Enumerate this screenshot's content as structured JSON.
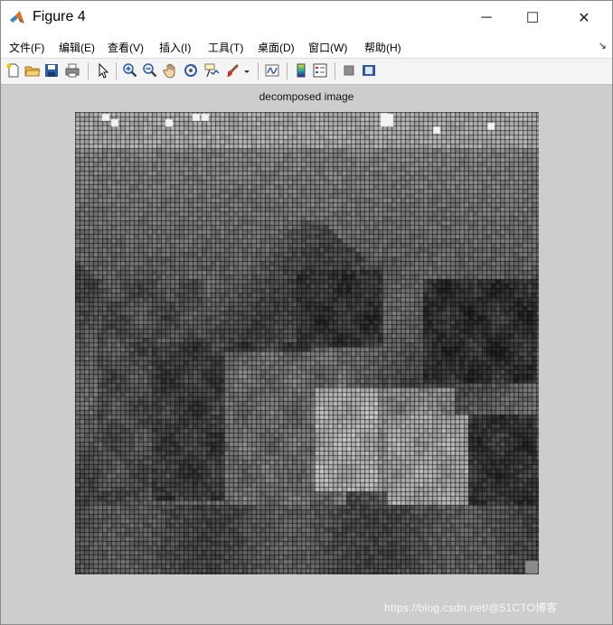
{
  "window": {
    "title": "Figure 4",
    "controls": {
      "minimize": "─",
      "maximize": "☐",
      "close": "✕"
    }
  },
  "menubar": {
    "items": [
      "文件(F)",
      "编辑(E)",
      "查看(V)",
      "插入(I)",
      "工具(T)",
      "桌面(D)",
      "窗口(W)",
      "帮助(H)"
    ],
    "dock_glyph": "↘"
  },
  "toolbar": {
    "buttons": [
      {
        "name": "new-figure-icon"
      },
      {
        "name": "open-file-icon"
      },
      {
        "name": "save-icon"
      },
      {
        "name": "print-icon"
      },
      {
        "name": "pointer-icon"
      },
      {
        "name": "zoom-in-icon"
      },
      {
        "name": "zoom-out-icon"
      },
      {
        "name": "pan-hand-icon"
      },
      {
        "name": "rotate-3d-icon"
      },
      {
        "name": "data-cursor-icon"
      },
      {
        "name": "brush-icon"
      },
      {
        "name": "link-plot-icon"
      },
      {
        "name": "colorbar-icon"
      },
      {
        "name": "legend-icon"
      },
      {
        "name": "hide-plot-tools-icon"
      },
      {
        "name": "show-plot-tools-icon"
      }
    ]
  },
  "figure": {
    "title": "decomposed image"
  },
  "watermark": "https://blog.csdn.net/@51CTO博客"
}
